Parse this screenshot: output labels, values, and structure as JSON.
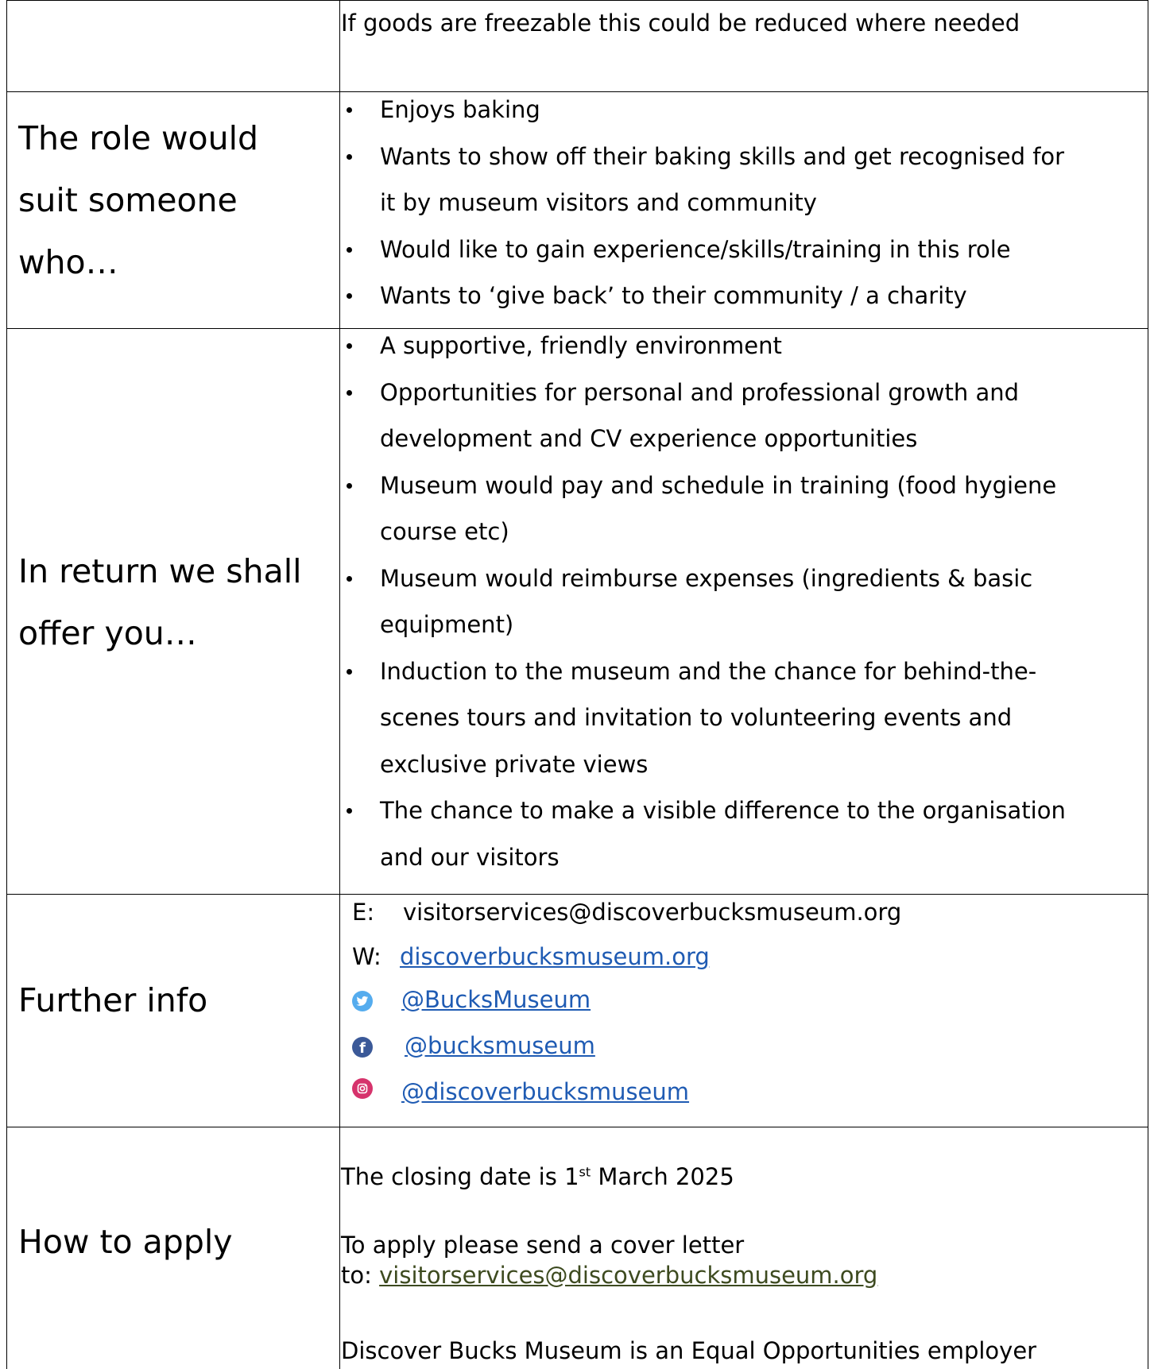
{
  "rows": {
    "top": {
      "text": "If goods are freezable this could be reduced where needed"
    },
    "suit": {
      "label_lines": [
        "The role would",
        "suit someone",
        "who…"
      ],
      "bullets": [
        [
          "Enjoys baking"
        ],
        [
          "Wants to show off their baking skills and get recognised for",
          "it by museum visitors and community"
        ],
        [
          "Would like to gain experience/skills/training in this role"
        ],
        [
          "Wants to ‘give back’ to their community / a charity"
        ]
      ]
    },
    "offer": {
      "label_lines": [
        "In return we shall",
        "offer you…"
      ],
      "bullets": [
        [
          "A supportive, friendly environment"
        ],
        [
          "Opportunities for personal and professional growth and",
          "development and CV experience opportunities"
        ],
        [
          "Museum would pay and schedule in training (food hygiene",
          "course etc)"
        ],
        [
          "Museum would reimburse expenses (ingredients & basic",
          "equipment)"
        ],
        [
          "Induction to the museum and the chance for behind-the-",
          "scenes tours and invitation to volunteering events and",
          "exclusive private views"
        ],
        [
          "The chance to make a visible difference to the organisation",
          "and our visitors"
        ]
      ]
    },
    "info": {
      "label": "Further info",
      "email_key": "E:",
      "email": "visitorservices@discoverbucksmuseum.org",
      "web_key": "W:",
      "web": "discoverbucksmuseum.org",
      "twitter": "@BucksMuseum",
      "facebook": "@bucksmuseum",
      "instagram": "@discoverbucksmuseum",
      "icons": [
        "twitter-icon",
        "facebook-icon",
        "instagram-icon"
      ],
      "colors": {
        "link": "#1f5bb3",
        "twitter": "#55acee",
        "facebook": "#3b5998",
        "instagram": "#d6336c"
      }
    },
    "apply": {
      "label": "How to apply",
      "closing_prefix": "The closing date is 1",
      "closing_sup": "st",
      "closing_suffix": " March 2025",
      "apply_line1": "To apply please send a cover letter",
      "apply_to": "to: ",
      "apply_email": "visitorservices@discoverbucksmuseum.org",
      "equal": "Discover Bucks Museum is an Equal Opportunities employer"
    }
  }
}
